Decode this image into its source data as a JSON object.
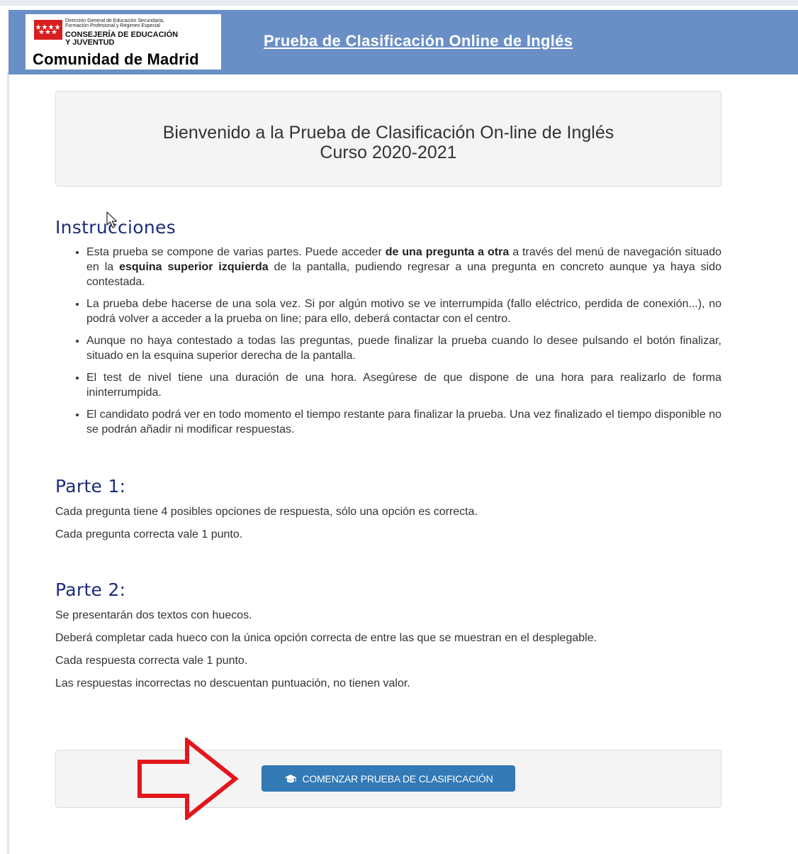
{
  "header": {
    "logo": {
      "small_line1": "Dirección General de Educación Secundaria,",
      "small_line2": "Formación Profesional y Régimen Especial",
      "consejeria_line1": "CONSEJERÍA DE EDUCACIÓN",
      "consejeria_line2": "Y JUVENTUD",
      "comunidad": "Comunidad de Madrid"
    },
    "title": "Prueba de Clasificación Online de Inglés",
    "background_color": "#6a8fc7"
  },
  "welcome": {
    "line1": "Bienvenido a la Prueba de Clasificación On-line de Inglés",
    "line2": "Curso 2020-2021"
  },
  "instructions": {
    "heading": "Instrucciones",
    "items": [
      {
        "t1": "Esta prueba se compone de varias partes. Puede acceder ",
        "b1": "de una pregunta a otra",
        "t2": " a través del menú de navegación situado en la ",
        "b2": "esquina superior izquierda",
        "t3": " de la pantalla, pudiendo regresar a una pregunta en concreto aunque ya haya sido contestada."
      },
      {
        "text": "La prueba debe hacerse de una sola vez. Si por algún motivo se ve interrumpida (fallo eléctrico, perdida de conexión...), no podrá volver a acceder a la prueba on line; para ello, deberá contactar con el centro."
      },
      {
        "text": "Aunque no haya contestado a todas las preguntas, puede finalizar la prueba cuando lo desee pulsando el botón finalizar, situado en la esquina superior derecha de la pantalla."
      },
      {
        "text": "El test de nivel tiene una duración de una hora. Asegúrese de que dispone de una hora para realizarlo de forma ininterrumpida."
      },
      {
        "text": "El candidato podrá ver en todo momento el tiempo restante para finalizar la prueba. Una vez finalizado el tiempo disponible no se podrán añadir ni modificar respuestas."
      }
    ]
  },
  "parte1": {
    "heading": "Parte 1:",
    "lines": [
      "Cada pregunta tiene 4 posibles opciones de respuesta, sólo una opción es correcta.",
      "Cada pregunta correcta vale 1 punto."
    ]
  },
  "parte2": {
    "heading": "Parte 2:",
    "lines": [
      "Se presentarán dos textos con huecos.",
      "Deberá completar cada hueco con la única opción correcta de entre las que se muestran en el desplegable.",
      "Cada respuesta correcta vale 1 punto.",
      "Las respuestas incorrectas no descuentan puntuación, no tienen valor."
    ]
  },
  "action": {
    "button_label": "COMENZAR PRUEBA DE CLASIFICACIÓN",
    "button_icon": "graduation-cap-icon",
    "button_color": "#337ab7",
    "arrow_color": "#e3161c"
  }
}
